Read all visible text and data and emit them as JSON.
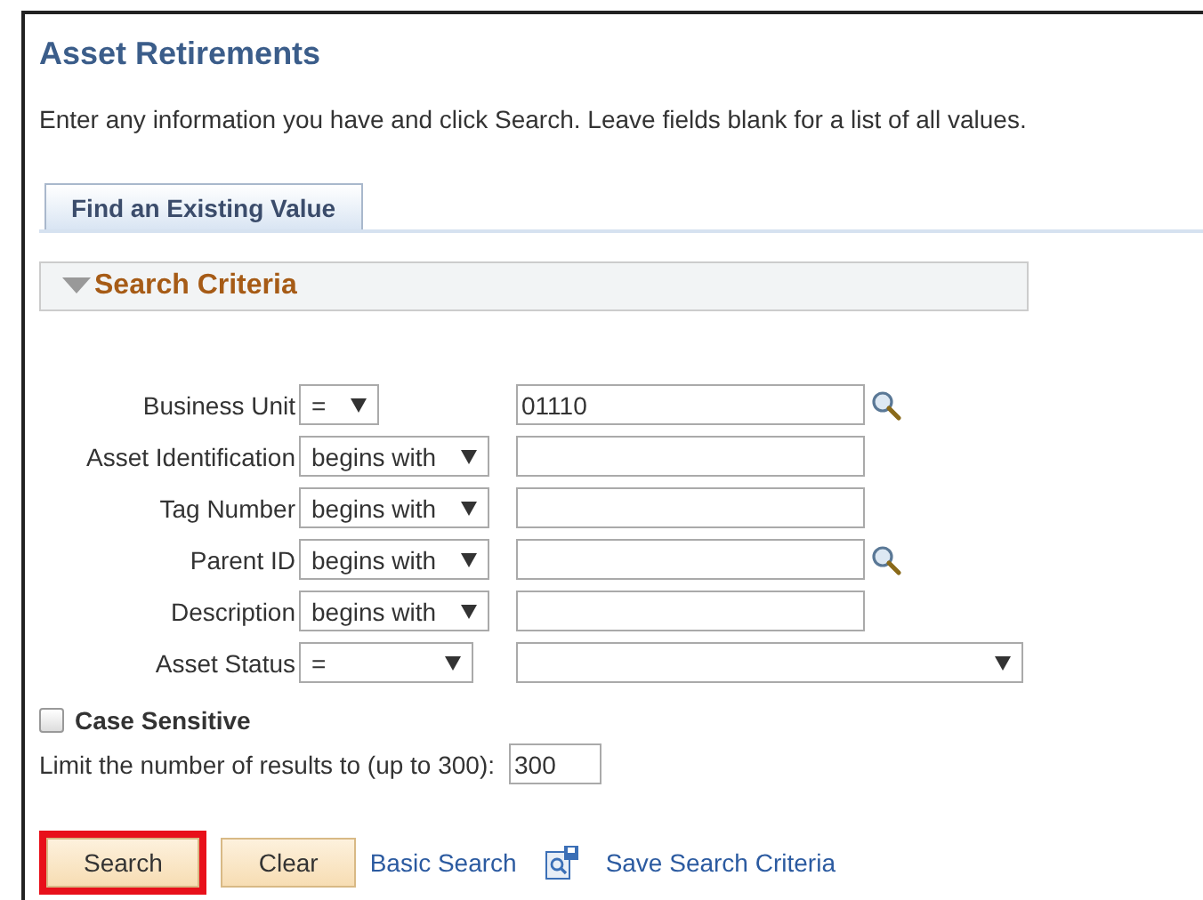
{
  "page": {
    "title": "Asset Retirements",
    "instructions": "Enter any information you have and click Search. Leave fields blank for a list of all values."
  },
  "tabs": [
    {
      "label": "Find an Existing Value",
      "selected": true
    }
  ],
  "section": {
    "title": "Search Criteria",
    "expanded": true
  },
  "criteria": [
    {
      "label": "Business Unit",
      "operator": "=",
      "kind": "text",
      "value": "01110",
      "lookup": true
    },
    {
      "label": "Asset Identification",
      "operator": "begins with",
      "kind": "text",
      "lookup": false
    },
    {
      "label": "Tag Number",
      "operator": "begins with",
      "kind": "text",
      "lookup": false
    },
    {
      "label": "Parent ID",
      "operator": "begins with",
      "kind": "text",
      "lookup": true
    },
    {
      "label": "Description",
      "operator": "begins with",
      "kind": "text",
      "lookup": false
    },
    {
      "label": "Asset Status",
      "operator": "=",
      "kind": "select",
      "lookup": false
    }
  ],
  "case_sensitive": {
    "label": "Case Sensitive",
    "checked": false
  },
  "limit": {
    "label": "Limit the number of results to (up to 300):",
    "value": "300"
  },
  "actions": [
    {
      "kind": "button",
      "label": "Search",
      "highlighted": true
    },
    {
      "kind": "button",
      "label": "Clear",
      "highlighted": false
    },
    {
      "kind": "link",
      "label": "Basic Search"
    },
    {
      "kind": "icon-link",
      "label": "Save Search Criteria"
    }
  ]
}
